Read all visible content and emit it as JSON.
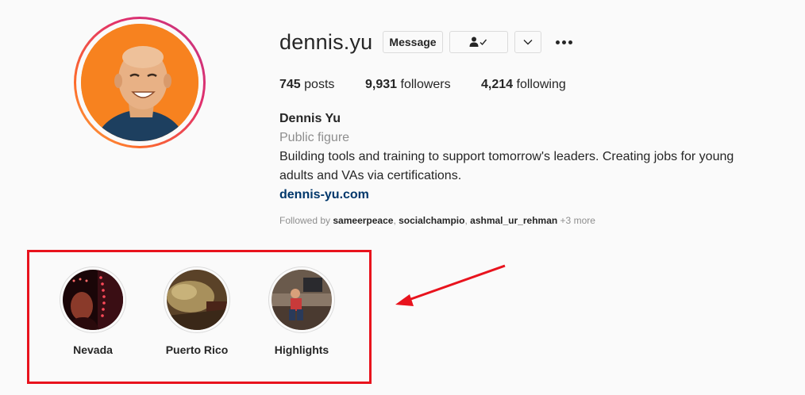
{
  "profile": {
    "username": "dennis.yu",
    "buttons": {
      "message_label": "Message",
      "following_icon": "person-check-icon",
      "dropdown_icon": "chevron-down-icon",
      "options_icon": "more-options-icon"
    },
    "stats": {
      "posts_count": "745",
      "posts_label": " posts",
      "followers_count": "9,931",
      "followers_label": " followers",
      "following_count": "4,214",
      "following_label": " following"
    },
    "bio": {
      "name": "Dennis Yu",
      "category": "Public figure",
      "text": "Building tools and training to support tomorrow's leaders. Creating jobs for young adults and VAs via certifications.",
      "link": "dennis-yu.com"
    },
    "followed_by": {
      "prefix": "Followed by ",
      "users": [
        "sameerpeace",
        "socialchampio",
        "ashmal_ur_rehman"
      ],
      "more": " +3 more"
    }
  },
  "highlights": [
    {
      "label": "Nevada"
    },
    {
      "label": "Puerto Rico"
    },
    {
      "label": "Highlights"
    }
  ],
  "colors": {
    "annotation_red": "#e8131d",
    "avatar_bg": "#f7821f",
    "link": "#00376b",
    "muted": "#8e8e8e"
  }
}
